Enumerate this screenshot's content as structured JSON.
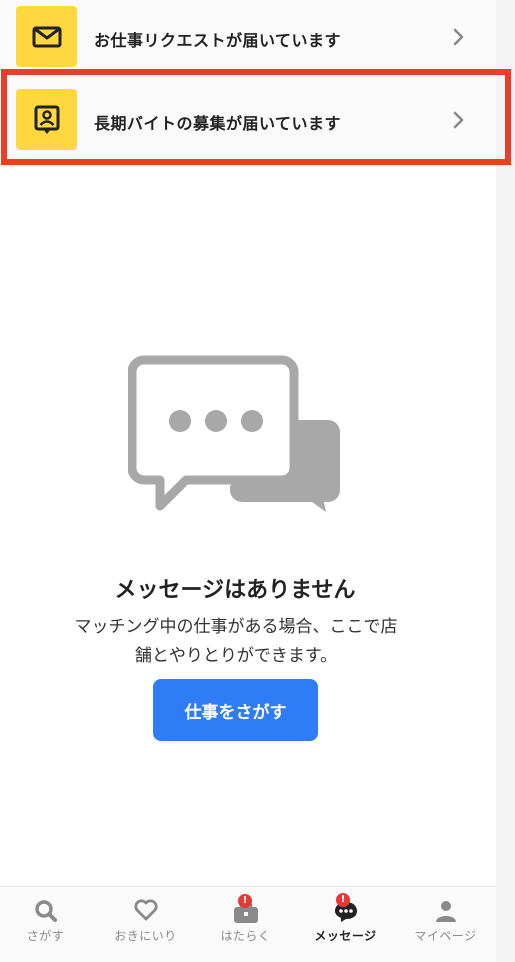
{
  "notices": [
    {
      "icon": "envelope-icon",
      "label": "お仕事リクエストが届いています"
    },
    {
      "icon": "profile-card-icon",
      "label": "長期バイトの募集が届いています"
    }
  ],
  "empty_state": {
    "icon": "chat-bubbles-icon",
    "title": "メッセージはありません",
    "description_line1": "マッチング中の仕事がある場合、ここで店",
    "description_line2": "舗とやりとりができます。",
    "button_label": "仕事をさがす"
  },
  "tabs": [
    {
      "label": "さがす",
      "icon": "search-icon",
      "active": false
    },
    {
      "label": "おきにいり",
      "icon": "heart-icon",
      "active": false
    },
    {
      "label": "はたらく",
      "icon": "briefcase-icon",
      "active": false,
      "badge": "!"
    },
    {
      "label": "メッセージ",
      "icon": "chat-icon",
      "active": true,
      "badge": "!"
    },
    {
      "label": "マイページ",
      "icon": "person-icon",
      "active": false
    }
  ],
  "colors": {
    "accent_yellow": "#ffd83f",
    "primary_blue": "#2f7df6",
    "highlight_red": "#ea3e2b",
    "badge_red": "#e53935"
  }
}
